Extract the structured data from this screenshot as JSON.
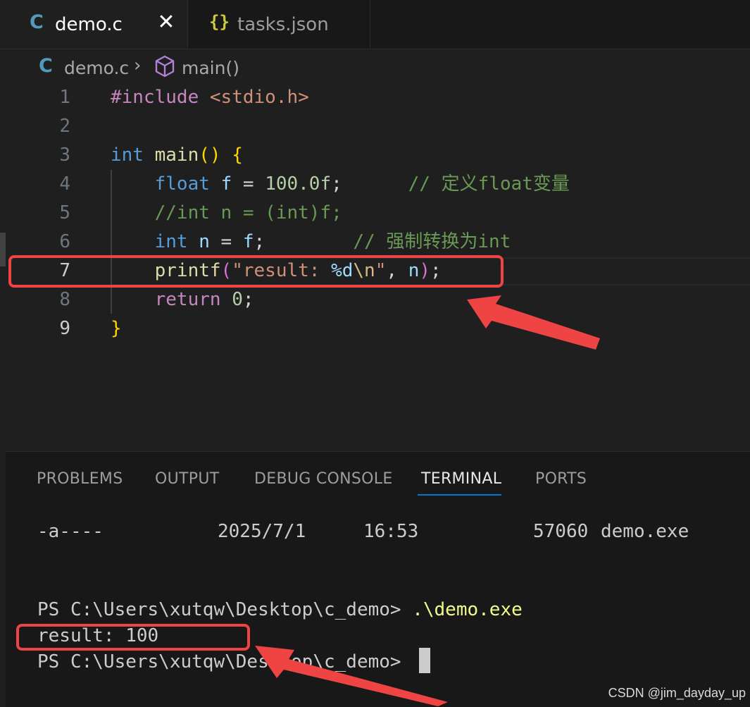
{
  "tabs": [
    {
      "icon": "C",
      "label": "demo.c",
      "close": "✕"
    },
    {
      "icon": "{}",
      "label": "tasks.json"
    }
  ],
  "breadcrumb": {
    "icon": "C",
    "file": "demo.c",
    "separator": "›",
    "symbol": "main()"
  },
  "editor": {
    "line_numbers": [
      "1",
      "2",
      "3",
      "4",
      "5",
      "6",
      "7",
      "8",
      "9"
    ],
    "current_line": "7"
  },
  "panel": {
    "tabs": [
      "PROBLEMS",
      "OUTPUT",
      "DEBUG CONSOLE",
      "TERMINAL",
      "PORTS"
    ],
    "active_tab": "TERMINAL"
  },
  "terminal": {
    "listing": {
      "mode": "-a----",
      "date": "2025/7/1",
      "time": "16:53",
      "size": "57060",
      "name": "demo.exe"
    },
    "prompt1": "PS C:\\Users\\xutqw\\Desktop\\c_demo>",
    "command": ".\\demo.exe",
    "output": "result: 100",
    "prompt2": "PS C:\\Users\\xutqw\\Desktop\\c_demo>"
  },
  "watermark": "CSDN @jim_dayday_up",
  "colors": {
    "annotation": "#ef4444",
    "accent": "#0078d4"
  }
}
